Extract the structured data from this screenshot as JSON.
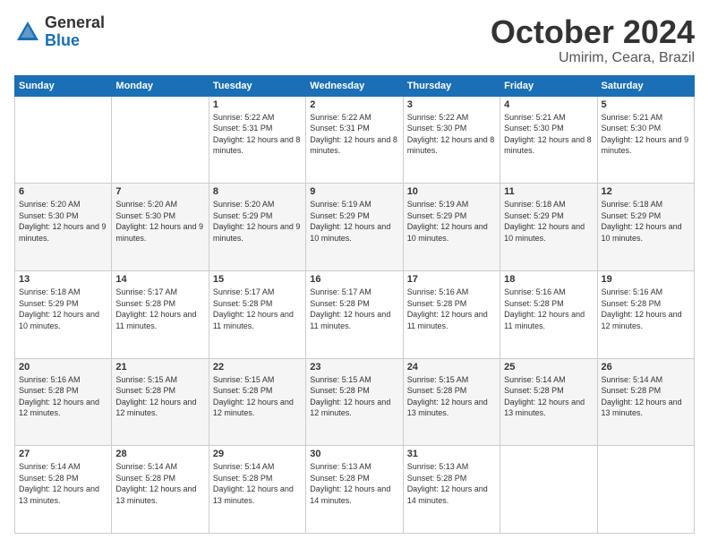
{
  "logo": {
    "general": "General",
    "blue": "Blue"
  },
  "title": "October 2024",
  "location": "Umirim, Ceara, Brazil",
  "weekdays": [
    "Sunday",
    "Monday",
    "Tuesday",
    "Wednesday",
    "Thursday",
    "Friday",
    "Saturday"
  ],
  "weeks": [
    [
      {
        "day": "",
        "info": ""
      },
      {
        "day": "",
        "info": ""
      },
      {
        "day": "1",
        "info": "Sunrise: 5:22 AM\nSunset: 5:31 PM\nDaylight: 12 hours and 8 minutes."
      },
      {
        "day": "2",
        "info": "Sunrise: 5:22 AM\nSunset: 5:31 PM\nDaylight: 12 hours and 8 minutes."
      },
      {
        "day": "3",
        "info": "Sunrise: 5:22 AM\nSunset: 5:30 PM\nDaylight: 12 hours and 8 minutes."
      },
      {
        "day": "4",
        "info": "Sunrise: 5:21 AM\nSunset: 5:30 PM\nDaylight: 12 hours and 8 minutes."
      },
      {
        "day": "5",
        "info": "Sunrise: 5:21 AM\nSunset: 5:30 PM\nDaylight: 12 hours and 9 minutes."
      }
    ],
    [
      {
        "day": "6",
        "info": "Sunrise: 5:20 AM\nSunset: 5:30 PM\nDaylight: 12 hours and 9 minutes."
      },
      {
        "day": "7",
        "info": "Sunrise: 5:20 AM\nSunset: 5:30 PM\nDaylight: 12 hours and 9 minutes."
      },
      {
        "day": "8",
        "info": "Sunrise: 5:20 AM\nSunset: 5:29 PM\nDaylight: 12 hours and 9 minutes."
      },
      {
        "day": "9",
        "info": "Sunrise: 5:19 AM\nSunset: 5:29 PM\nDaylight: 12 hours and 10 minutes."
      },
      {
        "day": "10",
        "info": "Sunrise: 5:19 AM\nSunset: 5:29 PM\nDaylight: 12 hours and 10 minutes."
      },
      {
        "day": "11",
        "info": "Sunrise: 5:18 AM\nSunset: 5:29 PM\nDaylight: 12 hours and 10 minutes."
      },
      {
        "day": "12",
        "info": "Sunrise: 5:18 AM\nSunset: 5:29 PM\nDaylight: 12 hours and 10 minutes."
      }
    ],
    [
      {
        "day": "13",
        "info": "Sunrise: 5:18 AM\nSunset: 5:29 PM\nDaylight: 12 hours and 10 minutes."
      },
      {
        "day": "14",
        "info": "Sunrise: 5:17 AM\nSunset: 5:28 PM\nDaylight: 12 hours and 11 minutes."
      },
      {
        "day": "15",
        "info": "Sunrise: 5:17 AM\nSunset: 5:28 PM\nDaylight: 12 hours and 11 minutes."
      },
      {
        "day": "16",
        "info": "Sunrise: 5:17 AM\nSunset: 5:28 PM\nDaylight: 12 hours and 11 minutes."
      },
      {
        "day": "17",
        "info": "Sunrise: 5:16 AM\nSunset: 5:28 PM\nDaylight: 12 hours and 11 minutes."
      },
      {
        "day": "18",
        "info": "Sunrise: 5:16 AM\nSunset: 5:28 PM\nDaylight: 12 hours and 11 minutes."
      },
      {
        "day": "19",
        "info": "Sunrise: 5:16 AM\nSunset: 5:28 PM\nDaylight: 12 hours and 12 minutes."
      }
    ],
    [
      {
        "day": "20",
        "info": "Sunrise: 5:16 AM\nSunset: 5:28 PM\nDaylight: 12 hours and 12 minutes."
      },
      {
        "day": "21",
        "info": "Sunrise: 5:15 AM\nSunset: 5:28 PM\nDaylight: 12 hours and 12 minutes."
      },
      {
        "day": "22",
        "info": "Sunrise: 5:15 AM\nSunset: 5:28 PM\nDaylight: 12 hours and 12 minutes."
      },
      {
        "day": "23",
        "info": "Sunrise: 5:15 AM\nSunset: 5:28 PM\nDaylight: 12 hours and 12 minutes."
      },
      {
        "day": "24",
        "info": "Sunrise: 5:15 AM\nSunset: 5:28 PM\nDaylight: 12 hours and 13 minutes."
      },
      {
        "day": "25",
        "info": "Sunrise: 5:14 AM\nSunset: 5:28 PM\nDaylight: 12 hours and 13 minutes."
      },
      {
        "day": "26",
        "info": "Sunrise: 5:14 AM\nSunset: 5:28 PM\nDaylight: 12 hours and 13 minutes."
      }
    ],
    [
      {
        "day": "27",
        "info": "Sunrise: 5:14 AM\nSunset: 5:28 PM\nDaylight: 12 hours and 13 minutes."
      },
      {
        "day": "28",
        "info": "Sunrise: 5:14 AM\nSunset: 5:28 PM\nDaylight: 12 hours and 13 minutes."
      },
      {
        "day": "29",
        "info": "Sunrise: 5:14 AM\nSunset: 5:28 PM\nDaylight: 12 hours and 13 minutes."
      },
      {
        "day": "30",
        "info": "Sunrise: 5:13 AM\nSunset: 5:28 PM\nDaylight: 12 hours and 14 minutes."
      },
      {
        "day": "31",
        "info": "Sunrise: 5:13 AM\nSunset: 5:28 PM\nDaylight: 12 hours and 14 minutes."
      },
      {
        "day": "",
        "info": ""
      },
      {
        "day": "",
        "info": ""
      }
    ]
  ]
}
